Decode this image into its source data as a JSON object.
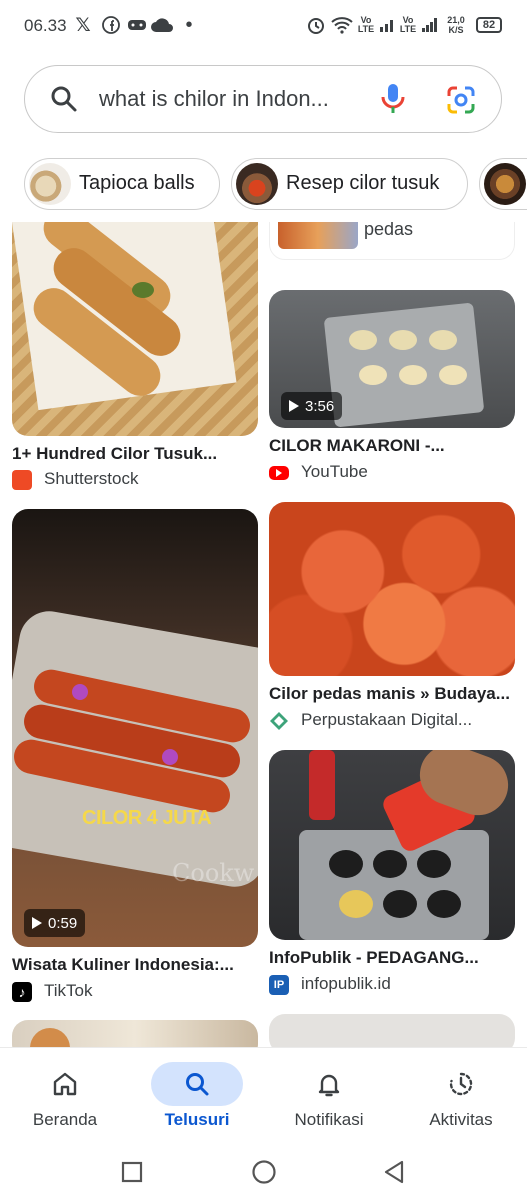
{
  "status_bar": {
    "time": "06.33",
    "speed_value": "21,0",
    "speed_unit": "K/S",
    "volte1": "Vo",
    "lte1": "LTE",
    "volte2": "Vo",
    "lte2": "LTE",
    "battery": "82"
  },
  "search": {
    "query": "what is chilor in Indon..."
  },
  "chips": [
    {
      "label": "Tapioca balls"
    },
    {
      "label": "Resep cilor tusuk"
    }
  ],
  "results": {
    "top_left_partial": {},
    "top_right_partial": {
      "title_fragment": "pedas"
    },
    "items": [
      {
        "title": "1+ Hundred Cilor Tusuk...",
        "source": "Shutterstock"
      },
      {
        "title": "CILOR MAKARONI -...",
        "source": "YouTube",
        "duration": "3:56"
      },
      {
        "title": "Cilor pedas manis » Budaya...",
        "source": "Perpustakaan Digital..."
      },
      {
        "title": "Wisata Kuliner Indonesia:...",
        "source": "TikTok",
        "duration": "0:59",
        "overlay_text": "CILOR 4 JUTA",
        "watermark": "Cookw"
      },
      {
        "title": "InfoPublik - PEDAGANG...",
        "source": "infopublik.id"
      }
    ]
  },
  "bottom_nav": [
    {
      "label": "Beranda",
      "icon": "home-icon"
    },
    {
      "label": "Telusuri",
      "icon": "search-icon",
      "active": true
    },
    {
      "label": "Notifikasi",
      "icon": "bell-icon"
    },
    {
      "label": "Aktivitas",
      "icon": "activity-icon"
    }
  ],
  "colors": {
    "accent": "#0b57d0",
    "active_pill": "#d3e3fd",
    "youtube": "#ff0000",
    "shutterstock": "#ee4a25",
    "tiktok": "#000000",
    "infopublik": "#1a5fb4"
  }
}
